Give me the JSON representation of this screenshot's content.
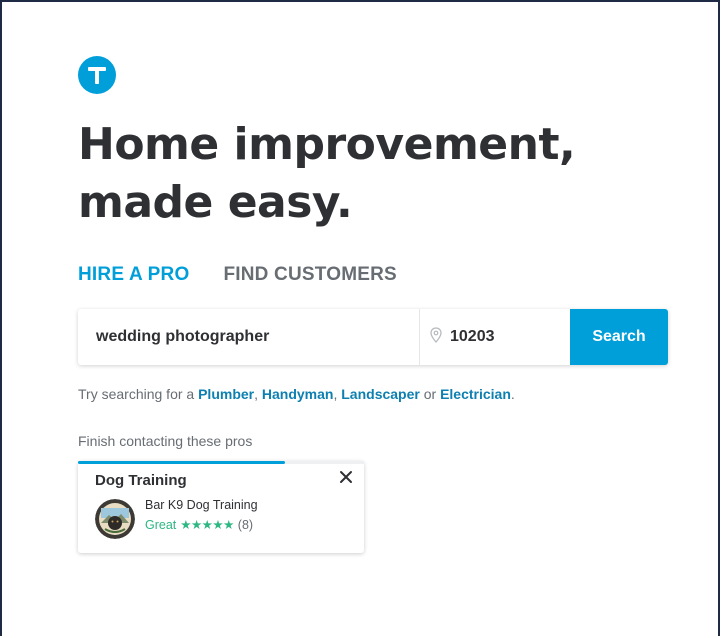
{
  "brand": {
    "accent_color": "#009fd9",
    "logo_icon": "thumbtack-logo-icon"
  },
  "headline": {
    "line1": "Home improvement,",
    "line2": "made easy."
  },
  "tabs": [
    {
      "label": "HIRE A PRO",
      "active": true
    },
    {
      "label": "FIND CUSTOMERS",
      "active": false
    }
  ],
  "search": {
    "service_value": "wedding photographer",
    "zip_icon": "location-pin-icon",
    "zip_value": "10203",
    "button_label": "Search"
  },
  "suggestions": {
    "prefix": "Try searching for a ",
    "items": [
      "Plumber",
      "Handyman",
      "Landscaper",
      "Electrician"
    ],
    "sep1": ", ",
    "sep2": ", ",
    "sep3": " or ",
    "suffix": "."
  },
  "finish": {
    "label": "Finish contacting these pros",
    "card": {
      "title": "Dog Training",
      "pro_name": "Bar K9 Dog Training",
      "rating_label": "Great",
      "stars": "★★★★★",
      "rating_value": 5,
      "review_count": "(8)",
      "close_icon": "close-icon"
    }
  }
}
